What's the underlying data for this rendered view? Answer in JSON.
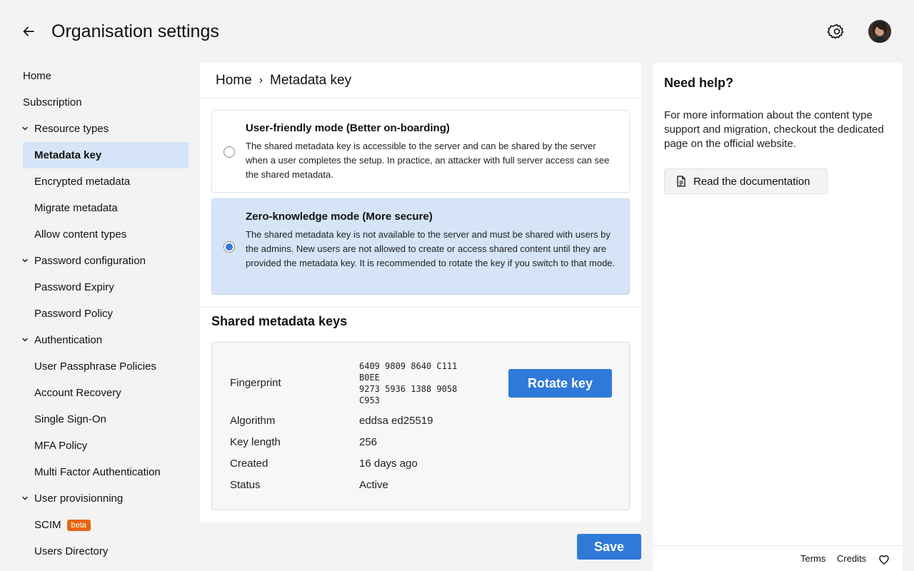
{
  "header": {
    "title": "Organisation settings"
  },
  "sidebar": {
    "items": [
      {
        "label": "Home"
      },
      {
        "label": "Subscription"
      },
      {
        "label": "Resource types"
      },
      {
        "label": "Metadata key"
      },
      {
        "label": "Encrypted metadata"
      },
      {
        "label": "Migrate metadata"
      },
      {
        "label": "Allow content types"
      },
      {
        "label": "Password configuration"
      },
      {
        "label": "Password Expiry"
      },
      {
        "label": "Password Policy"
      },
      {
        "label": "Authentication"
      },
      {
        "label": "User Passphrase Policies"
      },
      {
        "label": "Account Recovery"
      },
      {
        "label": "Single Sign-On"
      },
      {
        "label": "MFA Policy"
      },
      {
        "label": "Multi Factor Authentication"
      },
      {
        "label": "User provisionning"
      },
      {
        "label": "SCIM",
        "badge": "beta"
      },
      {
        "label": "Users Directory"
      }
    ],
    "active": "Metadata key"
  },
  "breadcrumb": {
    "root": "Home",
    "separator": "›",
    "current": "Metadata key"
  },
  "modes": [
    {
      "title": "User-friendly mode (Better on-boarding)",
      "description": "The shared metadata key is accessible to the server and can be shared by the server when a user completes the setup. In practice, an attacker with full server access can see the shared metadata.",
      "selected": false
    },
    {
      "title": "Zero-knowledge mode (More secure)",
      "description": "The shared metadata key is not available to the server and must be shared with users by the admins. New users are not allowed to create or access shared content until they are provided the metadata key. It is recommended to rotate the key if you switch to that mode.",
      "selected": true
    }
  ],
  "shared_keys": {
    "title": "Shared metadata keys",
    "fingerprint_label": "Fingerprint",
    "fingerprint_lines": [
      "6409 9809 8640 C111",
      "B0EE",
      "9273 5936 1388 9058",
      "C953"
    ],
    "algorithm_label": "Algorithm",
    "algorithm": "eddsa ed25519",
    "key_length_label": "Key length",
    "key_length": "256",
    "created_label": "Created",
    "created": "16 days ago",
    "status_label": "Status",
    "status": "Active",
    "rotate_label": "Rotate key"
  },
  "save_label": "Save",
  "help": {
    "title": "Need help?",
    "text": "For more information about the content type support and migration, checkout the dedicated page on the official website.",
    "doc_button": "Read the documentation"
  },
  "footer": {
    "terms": "Terms",
    "credits": "Credits"
  },
  "colors": {
    "primary": "#2f7ad8",
    "selected_bg": "#d5e5f7",
    "beta_badge": "#e5660e",
    "page_bg": "#f3f3f3"
  }
}
